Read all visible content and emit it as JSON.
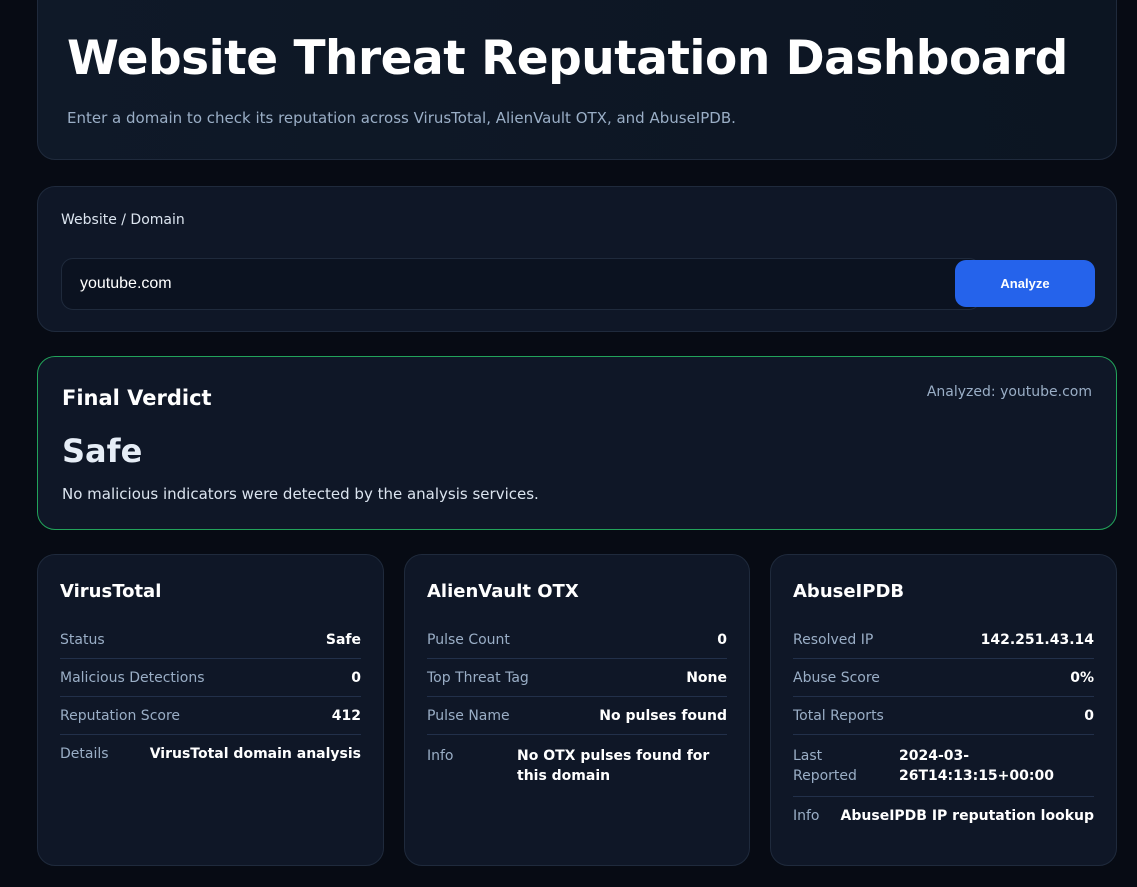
{
  "header": {
    "title": "Website Threat Reputation Dashboard",
    "subtitle": "Enter a domain to check its reputation across VirusTotal, AlienVault OTX, and AbuseIPDB."
  },
  "search": {
    "label": "Website / Domain",
    "value": "youtube.com",
    "button_label": "Analyze"
  },
  "verdict": {
    "title": "Final Verdict",
    "analyzed": "Analyzed: youtube.com",
    "value": "Safe",
    "description": "No malicious indicators were detected by the analysis services.",
    "border_color": "#22a35a"
  },
  "virustotal": {
    "title": "VirusTotal",
    "rows": [
      {
        "label": "Status",
        "value": "Safe"
      },
      {
        "label": "Malicious Detections",
        "value": "0"
      },
      {
        "label": "Reputation Score",
        "value": "412"
      },
      {
        "label": "Details",
        "value": "VirusTotal domain analysis"
      }
    ]
  },
  "otx": {
    "title": "AlienVault OTX",
    "rows": [
      {
        "label": "Pulse Count",
        "value": "0"
      },
      {
        "label": "Top Threat Tag",
        "value": "None"
      },
      {
        "label": "Pulse Name",
        "value": "No pulses found"
      },
      {
        "label": "Info",
        "value": "No OTX pulses found for this domain"
      }
    ]
  },
  "abuseipdb": {
    "title": "AbuseIPDB",
    "rows": [
      {
        "label": "Resolved IP",
        "value": "142.251.43.14"
      },
      {
        "label": "Abuse Score",
        "value": "0%"
      },
      {
        "label": "Total Reports",
        "value": "0"
      },
      {
        "label": "Last Reported",
        "value": "2024-03-26T14:13:15+00:00"
      },
      {
        "label": "Info",
        "value": "AbuseIPDB IP reputation lookup"
      }
    ]
  },
  "colors": {
    "accent": "#2563eb",
    "safe": "#22a35a",
    "background": "#070b14",
    "card": "#0f1727"
  }
}
